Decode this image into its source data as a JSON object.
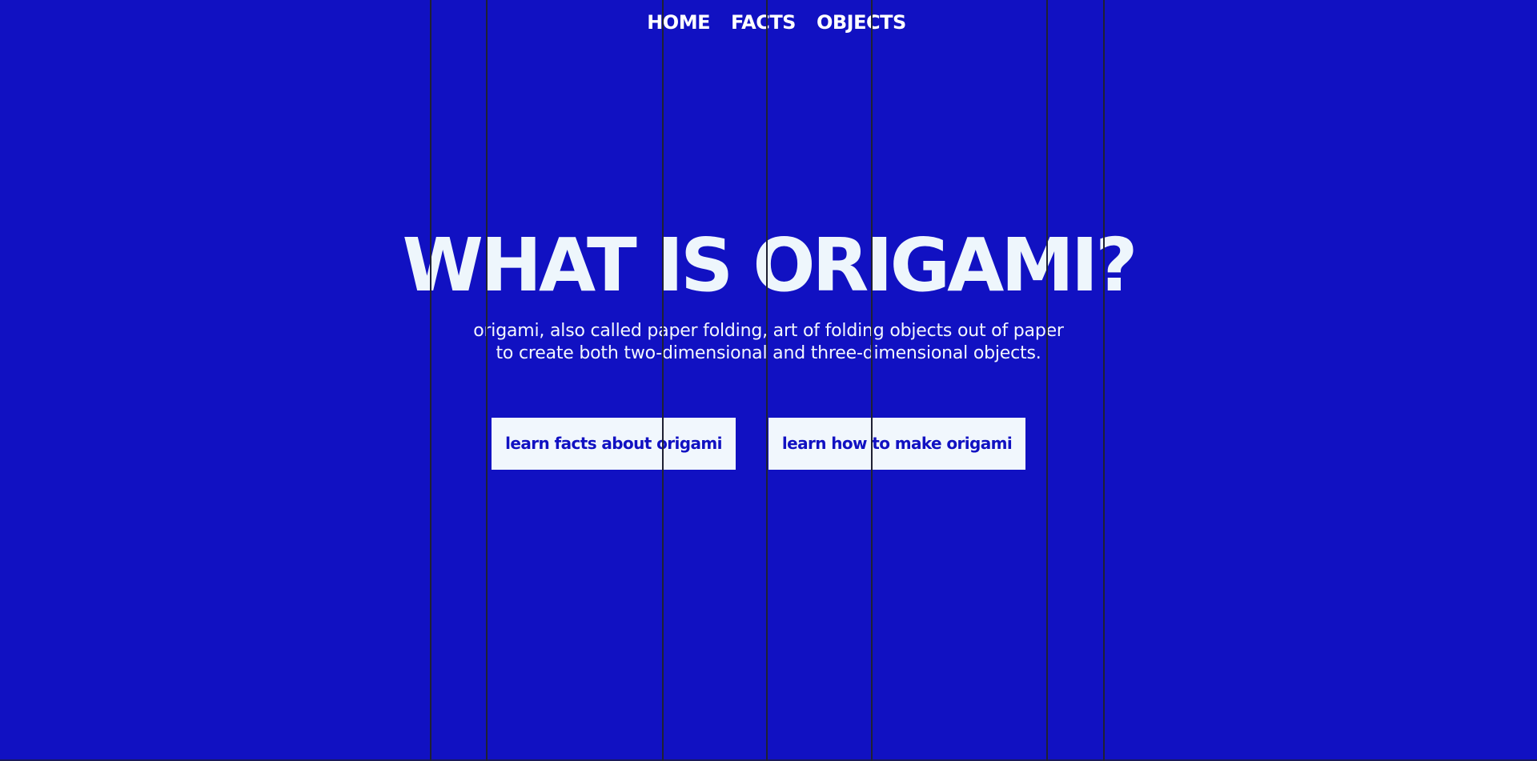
{
  "nav": {
    "items": [
      {
        "label": "HOME"
      },
      {
        "label": "FACTS"
      },
      {
        "label": "OBJECTS"
      }
    ]
  },
  "hero": {
    "title": "WHAT IS ORIGAMI?",
    "subtitle": "origami, also called paper folding, art of folding objects out of paper to create both two-dimensional and three-dimensional objects."
  },
  "buttons": {
    "facts_label": "learn facts about origami",
    "make_label": "learn how to make origami"
  },
  "colors": {
    "background": "#1111c2",
    "text_light": "#f1f7fd",
    "button_bg": "#f1f7fd",
    "button_text": "#1111c2",
    "overlay_line": "#1f2133"
  }
}
